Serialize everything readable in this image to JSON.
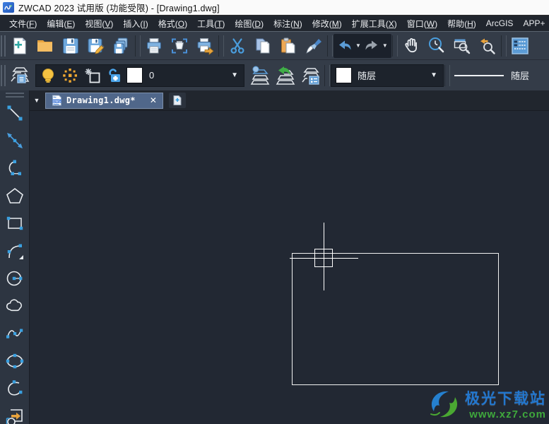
{
  "titlebar": {
    "title": "ZWCAD 2023 试用版 (功能受限) - [Drawing1.dwg]"
  },
  "menubar": {
    "items": [
      {
        "id": "file",
        "label": "文件",
        "key": "F"
      },
      {
        "id": "edit",
        "label": "编辑",
        "key": "E"
      },
      {
        "id": "view",
        "label": "视图",
        "key": "V"
      },
      {
        "id": "insert",
        "label": "插入",
        "key": "I"
      },
      {
        "id": "format",
        "label": "格式",
        "key": "O"
      },
      {
        "id": "tools",
        "label": "工具",
        "key": "T"
      },
      {
        "id": "draw",
        "label": "绘图",
        "key": "D"
      },
      {
        "id": "dimension",
        "label": "标注",
        "key": "N"
      },
      {
        "id": "modify",
        "label": "修改",
        "key": "M"
      },
      {
        "id": "express",
        "label": "扩展工具",
        "key": "X"
      },
      {
        "id": "window",
        "label": "窗口",
        "key": "W"
      },
      {
        "id": "help",
        "label": "帮助",
        "key": "H"
      },
      {
        "id": "arcgis",
        "label": "ArcGIS",
        "key": ""
      },
      {
        "id": "app-plus",
        "label": "APP+",
        "key": ""
      }
    ]
  },
  "toolbar_standard": {
    "buttons": [
      "new-drawing",
      "open",
      "save",
      "save-as",
      "save-all",
      "print",
      "print-preview",
      "plot-export",
      "cut",
      "copy",
      "paste",
      "format-painter",
      "undo",
      "redo",
      "pan",
      "zoom-realtime",
      "zoom-window",
      "zoom-previous",
      "properties-palette"
    ]
  },
  "toolbar_properties": {
    "layer_control": {
      "value": "0",
      "icons": [
        "layer-on-bulb",
        "layer-freeze-sun",
        "layer-viewport-freeze",
        "layer-unlock",
        "layer-color-swatch"
      ]
    },
    "layer_buttons": [
      "layer-properties-manager",
      "make-object-layer-current",
      "layer-previous",
      "layer-states-manager"
    ],
    "color_control": {
      "value": "随层"
    },
    "linetype_control": {
      "value": "随层"
    }
  },
  "tabbar": {
    "active_tab": "Drawing1.dwg*",
    "file_icon_label": "DWG"
  },
  "drawing_tools": [
    "line",
    "construction-line",
    "arc",
    "polygon",
    "rectangle",
    "arc-flyout",
    "circle",
    "revision-cloud",
    "spline",
    "ellipse",
    "ellipse-arc",
    "insert-block"
  ],
  "watermark": {
    "site_name": "极光下载站",
    "site_url": "www.xz7.com"
  },
  "colors": {
    "toolbar_bg": "#343c48",
    "canvas_bg": "#222833",
    "menubar_bg": "#21262e",
    "tab_active_bg": "#50678a",
    "icon_blue": "#4a9ede",
    "icon_light_blue": "#9dc3e6",
    "icon_orange": "#edab3f",
    "icon_yellow": "#f5c242",
    "watermark_blue": "#2277cf",
    "watermark_green": "#3fa83c"
  }
}
